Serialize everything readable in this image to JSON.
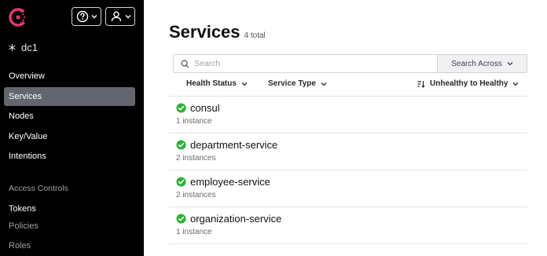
{
  "sidebar": {
    "datacenter": "dc1",
    "nav": [
      {
        "label": "Overview",
        "state": "normal"
      },
      {
        "label": "Services",
        "state": "active"
      },
      {
        "label": "Nodes",
        "state": "normal"
      },
      {
        "label": "Key/Value",
        "state": "normal"
      },
      {
        "label": "Intentions",
        "state": "normal"
      }
    ],
    "access_heading": "Access Controls",
    "access": [
      {
        "label": "Tokens",
        "state": "normal"
      },
      {
        "label": "Policies",
        "state": "muted"
      },
      {
        "label": "Roles",
        "state": "muted"
      }
    ]
  },
  "header": {
    "title": "Services",
    "count": "4 total"
  },
  "search": {
    "placeholder": "Search",
    "scope_label": "Search Across"
  },
  "filters": {
    "health": "Health Status",
    "type": "Service Type",
    "sort": "Unhealthy to Healthy"
  },
  "services": [
    {
      "name": "consul",
      "instances": "1 instance"
    },
    {
      "name": "department-service",
      "instances": "2 instances"
    },
    {
      "name": "employee-service",
      "instances": "2 instances"
    },
    {
      "name": "organization-service",
      "instances": "1 instance"
    }
  ],
  "colors": {
    "sidebar_bg": "#000000",
    "active_nav": "#63666f",
    "healthy": "#2eb039",
    "brand": "#e03875"
  }
}
